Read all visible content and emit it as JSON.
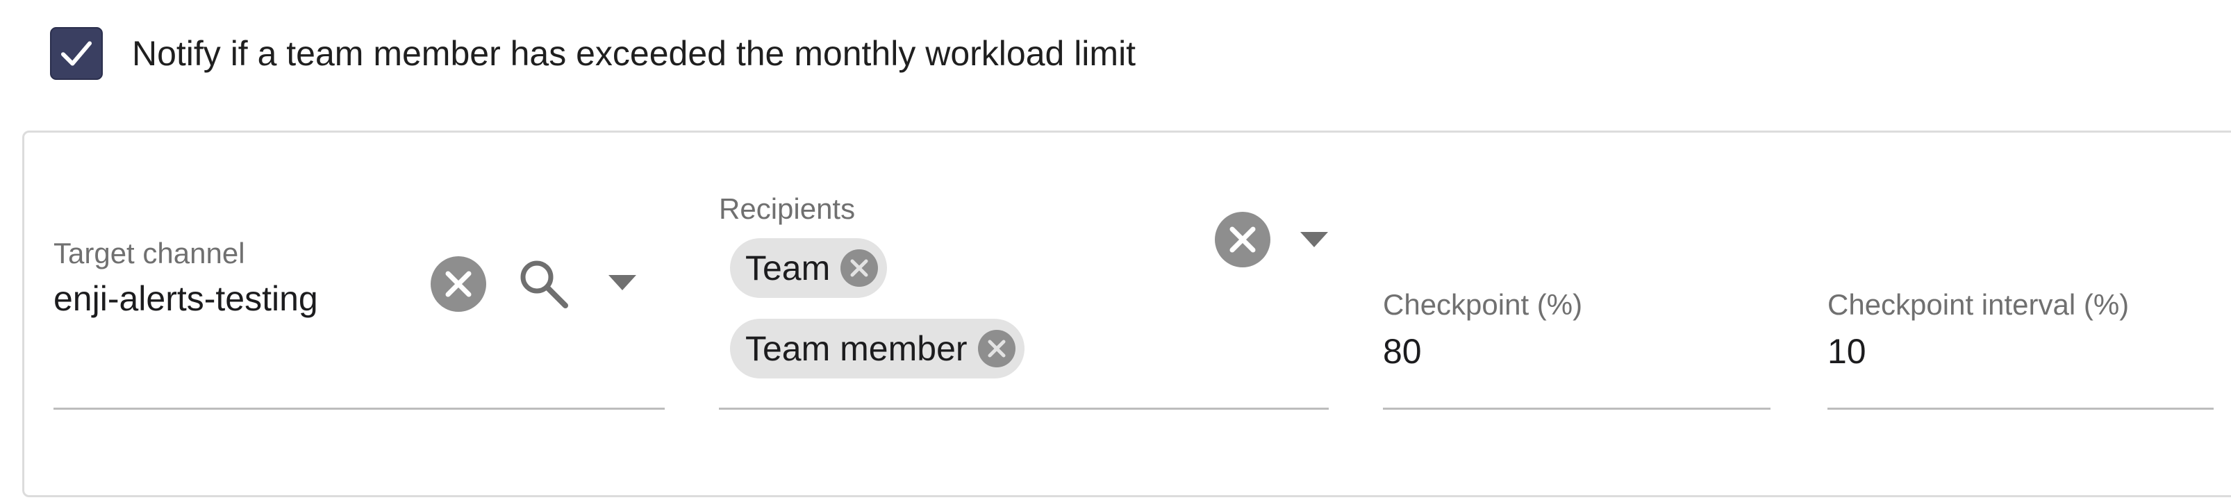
{
  "notify": {
    "label": "Notify if a team member has exceeded the monthly workload limit",
    "checked": true
  },
  "target_channel": {
    "label": "Target channel",
    "value": "enji-alerts-testing",
    "icons": [
      "clear-icon",
      "search-icon",
      "dropdown-arrow-icon"
    ]
  },
  "recipients": {
    "label": "Recipients",
    "chips": [
      {
        "label": "Team"
      },
      {
        "label": "Team member"
      }
    ],
    "icons": [
      "clear-icon",
      "dropdown-arrow-icon"
    ]
  },
  "checkpoint": {
    "label": "Checkpoint (%)",
    "value": "80"
  },
  "checkpoint_interval": {
    "label": "Checkpoint interval (%)",
    "value": "10"
  },
  "colors": {
    "checkbox_fill": "#3a3f61",
    "icon_grey": "#8e8e8e",
    "chip_bg": "#e3e3e3",
    "underline": "#bdbdbd"
  }
}
